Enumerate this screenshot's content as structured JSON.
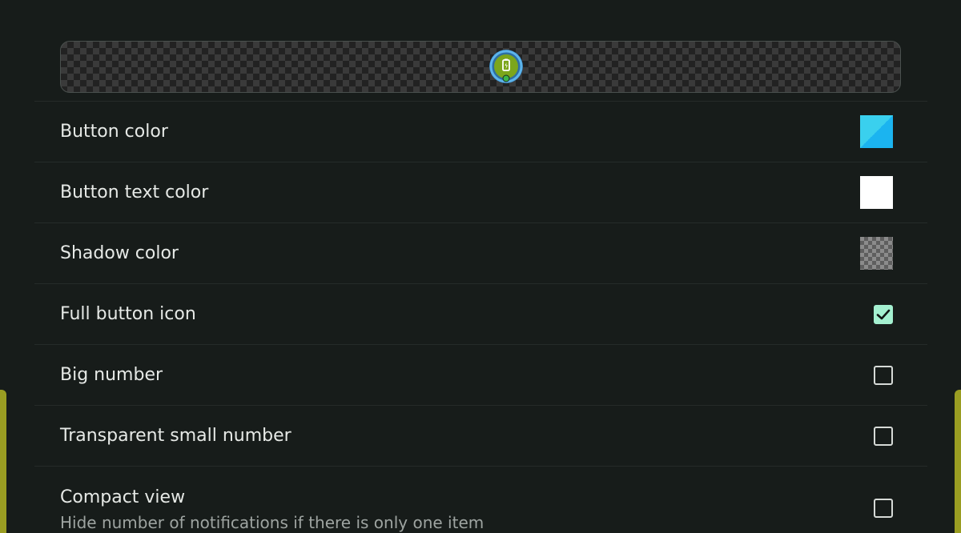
{
  "settings": {
    "items": [
      {
        "label": "Button color",
        "type": "color",
        "color": "#3ad0ee"
      },
      {
        "label": "Button text color",
        "type": "color",
        "color": "#ffffff"
      },
      {
        "label": "Shadow color",
        "type": "color",
        "color": "transparent"
      },
      {
        "label": "Full button icon",
        "type": "checkbox",
        "checked": true
      },
      {
        "label": "Big number",
        "type": "checkbox",
        "checked": false
      },
      {
        "label": "Transparent small number",
        "type": "checkbox",
        "checked": false
      },
      {
        "label": "Compact view",
        "subtitle": "Hide number of notifications if there is only one item",
        "type": "checkbox",
        "checked": false
      }
    ]
  },
  "colors": {
    "background": "#171c1a",
    "accent_handle": "#9a9d22",
    "check_fill": "#a4f0d0",
    "preview_button": "#7ca61b",
    "preview_ring": "#4aa3e0"
  }
}
